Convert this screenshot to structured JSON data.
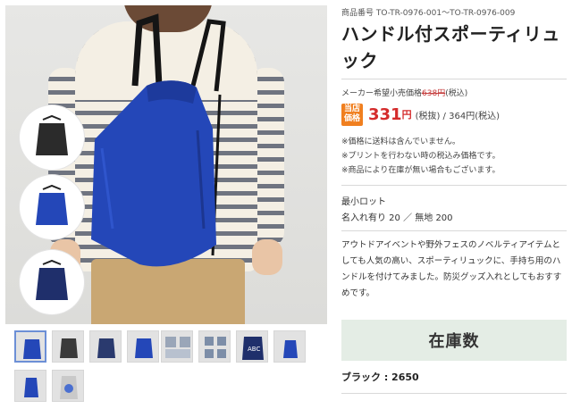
{
  "product": {
    "code": "商品番号 TO-TR-0976-001〜TO-TR-0976-009",
    "title": "ハンドル付スポーティリュック"
  },
  "pricing": {
    "msrp_label": "メーカー希望小売価格",
    "msrp_value": "638円",
    "msrp_tax": "(税込)",
    "badge_line1": "当店",
    "badge_line2": "価格",
    "price": "331",
    "price_unit": "円",
    "price_tax": "(税抜) / 364円(税込)"
  },
  "notes": [
    "※価格に送料は含んでいません。",
    "※プリントを行わない時の税込み価格です。",
    "※商品により在庫が無い場合もございます。"
  ],
  "lot": {
    "title": "最小ロット",
    "value": "名入れ有り 20 ／ 無地 200"
  },
  "description": "アウトドアイベントや野外フェスのノベルティアイテムとしても人気の高い、スポーティリュックに、手持ち用のハンドルを付けてみました。防災グッズ入れとしてもおすすめです。",
  "stock": {
    "header": "在庫数",
    "rows": [
      {
        "label": "ブラック : 2650"
      }
    ]
  },
  "gallery": {
    "color_swatches": [
      {
        "name": "black-bag",
        "color": "#2b2b2b"
      },
      {
        "name": "blue-bag",
        "color": "#2447b8"
      },
      {
        "name": "navy-bag",
        "color": "#1f2f6b"
      }
    ],
    "bag_color": "#2447b8",
    "thumb_colors": [
      "#2447b8",
      "#3a3a3a",
      "#2a3a6e",
      "#2447b8",
      "#9aa6b8",
      "#7d8ea8",
      "#1f2f6b",
      "#2447b8",
      "#2447b8",
      "#c9c9c9"
    ]
  },
  "colors": {
    "price_red": "#d42b2b",
    "badge_orange": "#f07f1f",
    "stock_header_bg": "#e4ede5",
    "active_thumb_border": "#6c8fd6"
  }
}
